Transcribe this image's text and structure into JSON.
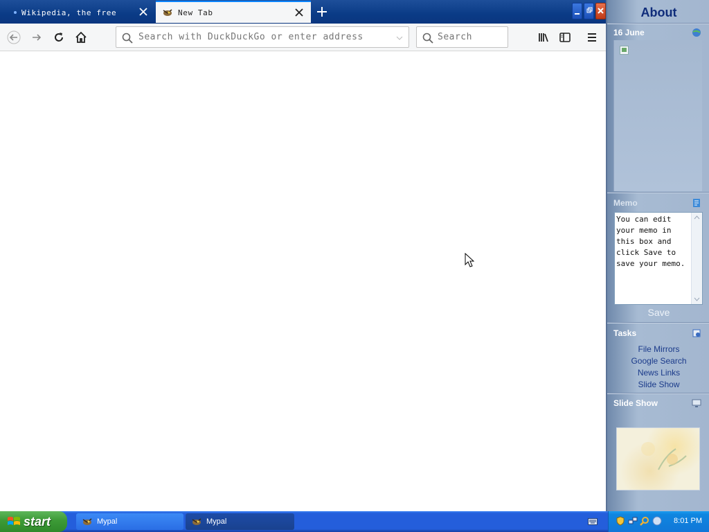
{
  "browser": {
    "tabs": [
      {
        "label": "Wikipedia, the free",
        "active": false
      },
      {
        "label": "New Tab",
        "active": true
      }
    ],
    "url_placeholder": "Search with DuckDuckGo or enter address",
    "search_placeholder": "Search"
  },
  "sidebar": {
    "title": "About",
    "date": "16 June",
    "memo": {
      "title": "Memo",
      "text": "You can edit your memo in this box and click Save to save your memo.",
      "save_label": "Save"
    },
    "tasks": {
      "title": "Tasks",
      "links": [
        "File Mirrors",
        "Google Search",
        "News Links",
        "Slide Show"
      ]
    },
    "slideshow": {
      "title": "Slide Show"
    }
  },
  "taskbar": {
    "start_label": "start",
    "buttons": [
      "Mypal",
      "Mypal"
    ],
    "clock": "8:01 PM"
  },
  "colors": {
    "tab_accent": "#0a84ff",
    "taskbar_blue": "#245edb",
    "start_green": "#3c9a36",
    "sidebar_title": "#0f2c7a"
  }
}
